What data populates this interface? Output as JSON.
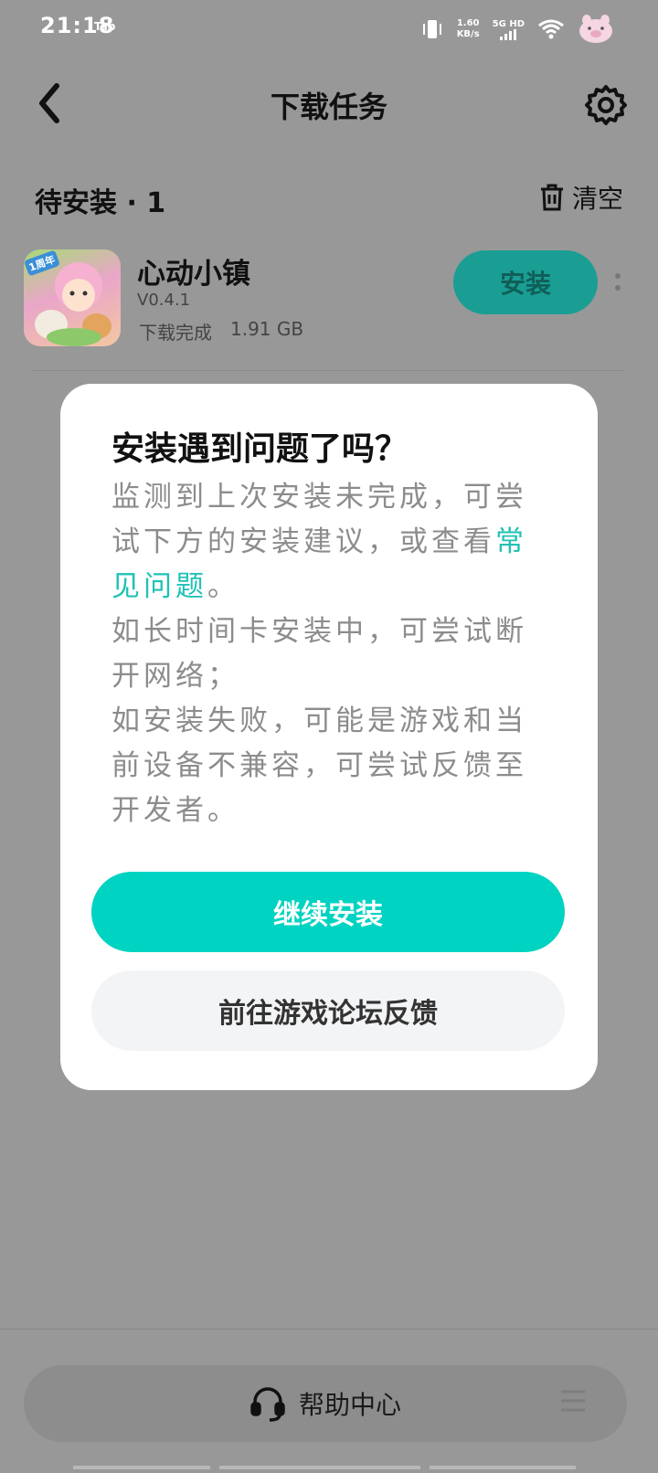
{
  "status": {
    "time": "21:18",
    "tap_label": "Tap",
    "speed_top": "1.60",
    "speed_bottom": "KB/s",
    "network": "5G HD"
  },
  "header": {
    "title": "下载任务"
  },
  "section": {
    "title": "待安装 · 1",
    "clear_label": "清空"
  },
  "app": {
    "name": "心动小镇",
    "version": "V0.4.1",
    "status": "下载完成",
    "size": "1.91 GB",
    "icon_badge": "1周年",
    "install_label": "安装"
  },
  "dialog": {
    "title": "安装遇到问题了吗？",
    "body_before_link": "监测到上次安装未完成，可尝试下方的安装建议，或查看",
    "link_text": "常见问题",
    "body_after_link": "。",
    "body_line2": "如长时间卡安装中，可尝试断开网络；",
    "body_line3": "如安装失败，可能是游戏和当前设备不兼容，可尝试反馈至开发者。",
    "primary_button": "继续安装",
    "secondary_button": "前往游戏论坛反馈"
  },
  "bottom": {
    "help_label": "帮助中心"
  },
  "colors": {
    "accent": "#00d3c1",
    "link": "#1fc2b5",
    "overlay_bg": "#989898"
  }
}
